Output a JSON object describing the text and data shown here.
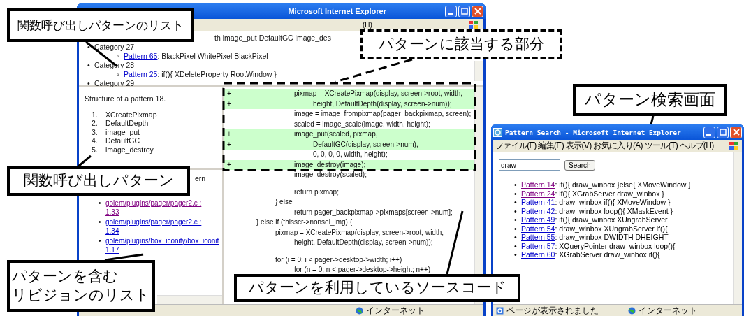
{
  "main_window": {
    "title": "Microsoft Internet Explorer",
    "menu_tail": "(H)",
    "pattern_list": {
      "partial_line": "th image_put DefaultGC image_des",
      "categories": [
        {
          "marker": "•",
          "label": "Category 27",
          "patterns": [
            {
              "marker": "◦",
              "link": "Pattern 65",
              "visited": false,
              "text": ": BlackPixel WhitePixel BlackPixel"
            }
          ]
        },
        {
          "marker": "•",
          "label": "Category 28",
          "patterns": [
            {
              "marker": "◦",
              "link": "Pattern 25",
              "visited": false,
              "text": ": if(){ XDeleteProperty RootWindow }"
            }
          ]
        },
        {
          "marker": "•",
          "label": "Category 29"
        }
      ]
    },
    "structure": {
      "title": "Structure of a pattern 18.",
      "items": [
        {
          "num": "1.",
          "name": "XCreatePixmap"
        },
        {
          "num": "2.",
          "name": "DefaultDepth"
        },
        {
          "num": "3.",
          "name": "image_put"
        },
        {
          "num": "4.",
          "name": "DefaultGC"
        },
        {
          "num": "5.",
          "name": "image_destroy"
        }
      ]
    },
    "revisions": {
      "partial_heading": "ern",
      "items": [
        {
          "marker": "•",
          "path": "golem/plugins/pager/pager2.c :",
          "rev": "1.33",
          "visited": true
        },
        {
          "marker": "•",
          "path": "golem/plugins/pager/pager2.c :",
          "rev": "1.34",
          "visited": false
        },
        {
          "marker": "•",
          "path": "golem/plugins/box_iconify/box_iconif",
          "rev": "1.17",
          "visited": false
        }
      ]
    },
    "code": [
      {
        "added": true,
        "prefix": "+",
        "text": "\t\tpixmap = XCreatePixmap(display, screen->root, width,"
      },
      {
        "added": true,
        "prefix": "+",
        "text": "\t\t\theight, DefaultDepth(display, screen->num));"
      },
      {
        "added": false,
        "text": "\t\timage = image_frompixmap(pager_backpixmap, screen);"
      },
      {
        "added": false,
        "text": "\t\tscaled = image_scale(image, width, height);"
      },
      {
        "added": true,
        "prefix": "+",
        "text": "\t\timage_put(scaled, pixmap,"
      },
      {
        "added": true,
        "prefix": "+",
        "text": "\t\t\tDefaultGC(display, screen->num),"
      },
      {
        "added": false,
        "text": "\t\t\t0, 0, 0, 0, width, height);"
      },
      {
        "added": true,
        "prefix": "+",
        "text": "\t\timage_destroy(image);"
      },
      {
        "added": false,
        "text": "\t\timage_destroy(scaled);"
      },
      {
        "added": false,
        "space_before": true,
        "text": "\t\treturn pixmap;"
      },
      {
        "added": false,
        "text": "\t} else"
      },
      {
        "added": false,
        "text": "\t\treturn pager_backpixmap->pixmaps[screen->num];"
      },
      {
        "added": false,
        "text": "} else if (thisscr->nonsel_img) {"
      },
      {
        "added": false,
        "text": "\tpixmap = XCreatePixmap(display, screen->root, width,"
      },
      {
        "added": false,
        "text": "\t\theight, DefaultDepth(display, screen->num));"
      },
      {
        "added": false,
        "space_before": true,
        "text": "\tfor (i = 0; i < pager->desktop->width; i++)"
      },
      {
        "added": false,
        "text": "\t\tfor (n = 0; n < pager->desktop->height; n++)"
      }
    ],
    "status_zone": "インターネット"
  },
  "search_window": {
    "title": "Pattern Search - Microsoft Internet Explorer",
    "menu": [
      "ファイル(F)",
      "編集(E)",
      "表示(V)",
      "お気に入り(A)",
      "ツール(T)",
      "ヘルプ(H)"
    ],
    "query": "draw",
    "search_button": "Search",
    "results": [
      {
        "marker": "•",
        "link": "Pattern 14",
        "visited": true,
        "text": ": if(){ draw_winbox }else{ XMoveWindow }"
      },
      {
        "marker": "•",
        "link": "Pattern 24",
        "visited": true,
        "text": ": if(){ XGrabServer draw_winbox }"
      },
      {
        "marker": "•",
        "link": "Pattern 41",
        "visited": false,
        "text": ": draw_winbox if(){ XMoveWindow }"
      },
      {
        "marker": "•",
        "link": "Pattern 42",
        "visited": false,
        "text": ": draw_winbox loop(){ XMaskEvent }"
      },
      {
        "marker": "•",
        "link": "Pattern 49",
        "visited": false,
        "text": ": if(){ draw_winbox XUngrabServer"
      },
      {
        "marker": "•",
        "link": "Pattern 54",
        "visited": false,
        "text": ": draw_winbox XUngrabServer if(){"
      },
      {
        "marker": "•",
        "link": "Pattern 55",
        "visited": false,
        "text": ": draw_winbox DWIDTH DHEIGHT"
      },
      {
        "marker": "•",
        "link": "Pattern 57",
        "visited": false,
        "text": ": XQueryPointer draw_winbox loop(){"
      },
      {
        "marker": "•",
        "link": "Pattern 60",
        "visited": false,
        "text": ": XGrabServer draw_winbox if(){"
      }
    ],
    "status": "ページが表示されました",
    "status_zone": "インターネット"
  },
  "callouts": [
    {
      "kind": "solid",
      "lines": [
        "関数呼び出しパターンのリスト"
      ]
    },
    {
      "kind": "dashed",
      "lines": [
        "パターンに該当する部分"
      ]
    },
    {
      "kind": "solid",
      "lines": [
        "パターン検索画面"
      ]
    },
    {
      "kind": "solid",
      "lines": [
        "関数呼び出しパターン"
      ]
    },
    {
      "kind": "solid",
      "lines": [
        "パターンを含む",
        "リビジョンのリスト"
      ]
    },
    {
      "kind": "solid",
      "lines": [
        "パターンを利用しているソースコード"
      ]
    }
  ]
}
